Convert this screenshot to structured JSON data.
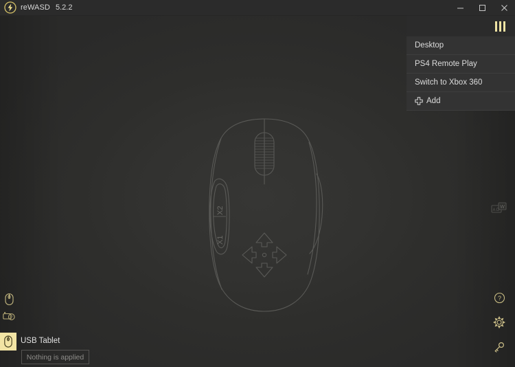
{
  "window": {
    "app_name": "reWASD",
    "version": "5.2.2",
    "logo_icon": "lightning-bolt-logo",
    "accent_color": "#efe3a3",
    "background_color": "#2b2b2b",
    "controls": [
      {
        "name": "minimize",
        "icon": "minimize-icon"
      },
      {
        "name": "maximize",
        "icon": "maximize-icon"
      },
      {
        "name": "close",
        "icon": "close-icon"
      }
    ]
  },
  "profile_menu": {
    "toggle_icon": "hamburger-bars-icon",
    "items": [
      {
        "label": "Desktop",
        "icon": null
      },
      {
        "label": "PS4 Remote Play",
        "icon": null
      },
      {
        "label": "Switch to Xbox 360",
        "icon": null
      },
      {
        "label": "Add",
        "icon": "plus-cross-icon"
      }
    ]
  },
  "canvas": {
    "device_diagram": "mouse-outline-diagram",
    "button_labels": [
      "X2",
      "X1"
    ],
    "elements": [
      "scroll-wheel",
      "side-buttons",
      "dpad-arrows"
    ]
  },
  "right_rail": {
    "mapping_icon": {
      "name": "keyboard-mapping-icon"
    },
    "bottom_icons": [
      {
        "name": "help-icon"
      },
      {
        "name": "settings-gear-icon"
      },
      {
        "name": "key-license-icon"
      }
    ]
  },
  "left_rail": {
    "devices": [
      {
        "name": "mouse-device-icon",
        "active": false
      },
      {
        "name": "gamepad-unmapped-icon",
        "active": false
      }
    ]
  },
  "status_bar": {
    "device_icon": "mouse-device-icon",
    "device_name": "USB Tablet",
    "applied_label": "Nothing is applied"
  }
}
